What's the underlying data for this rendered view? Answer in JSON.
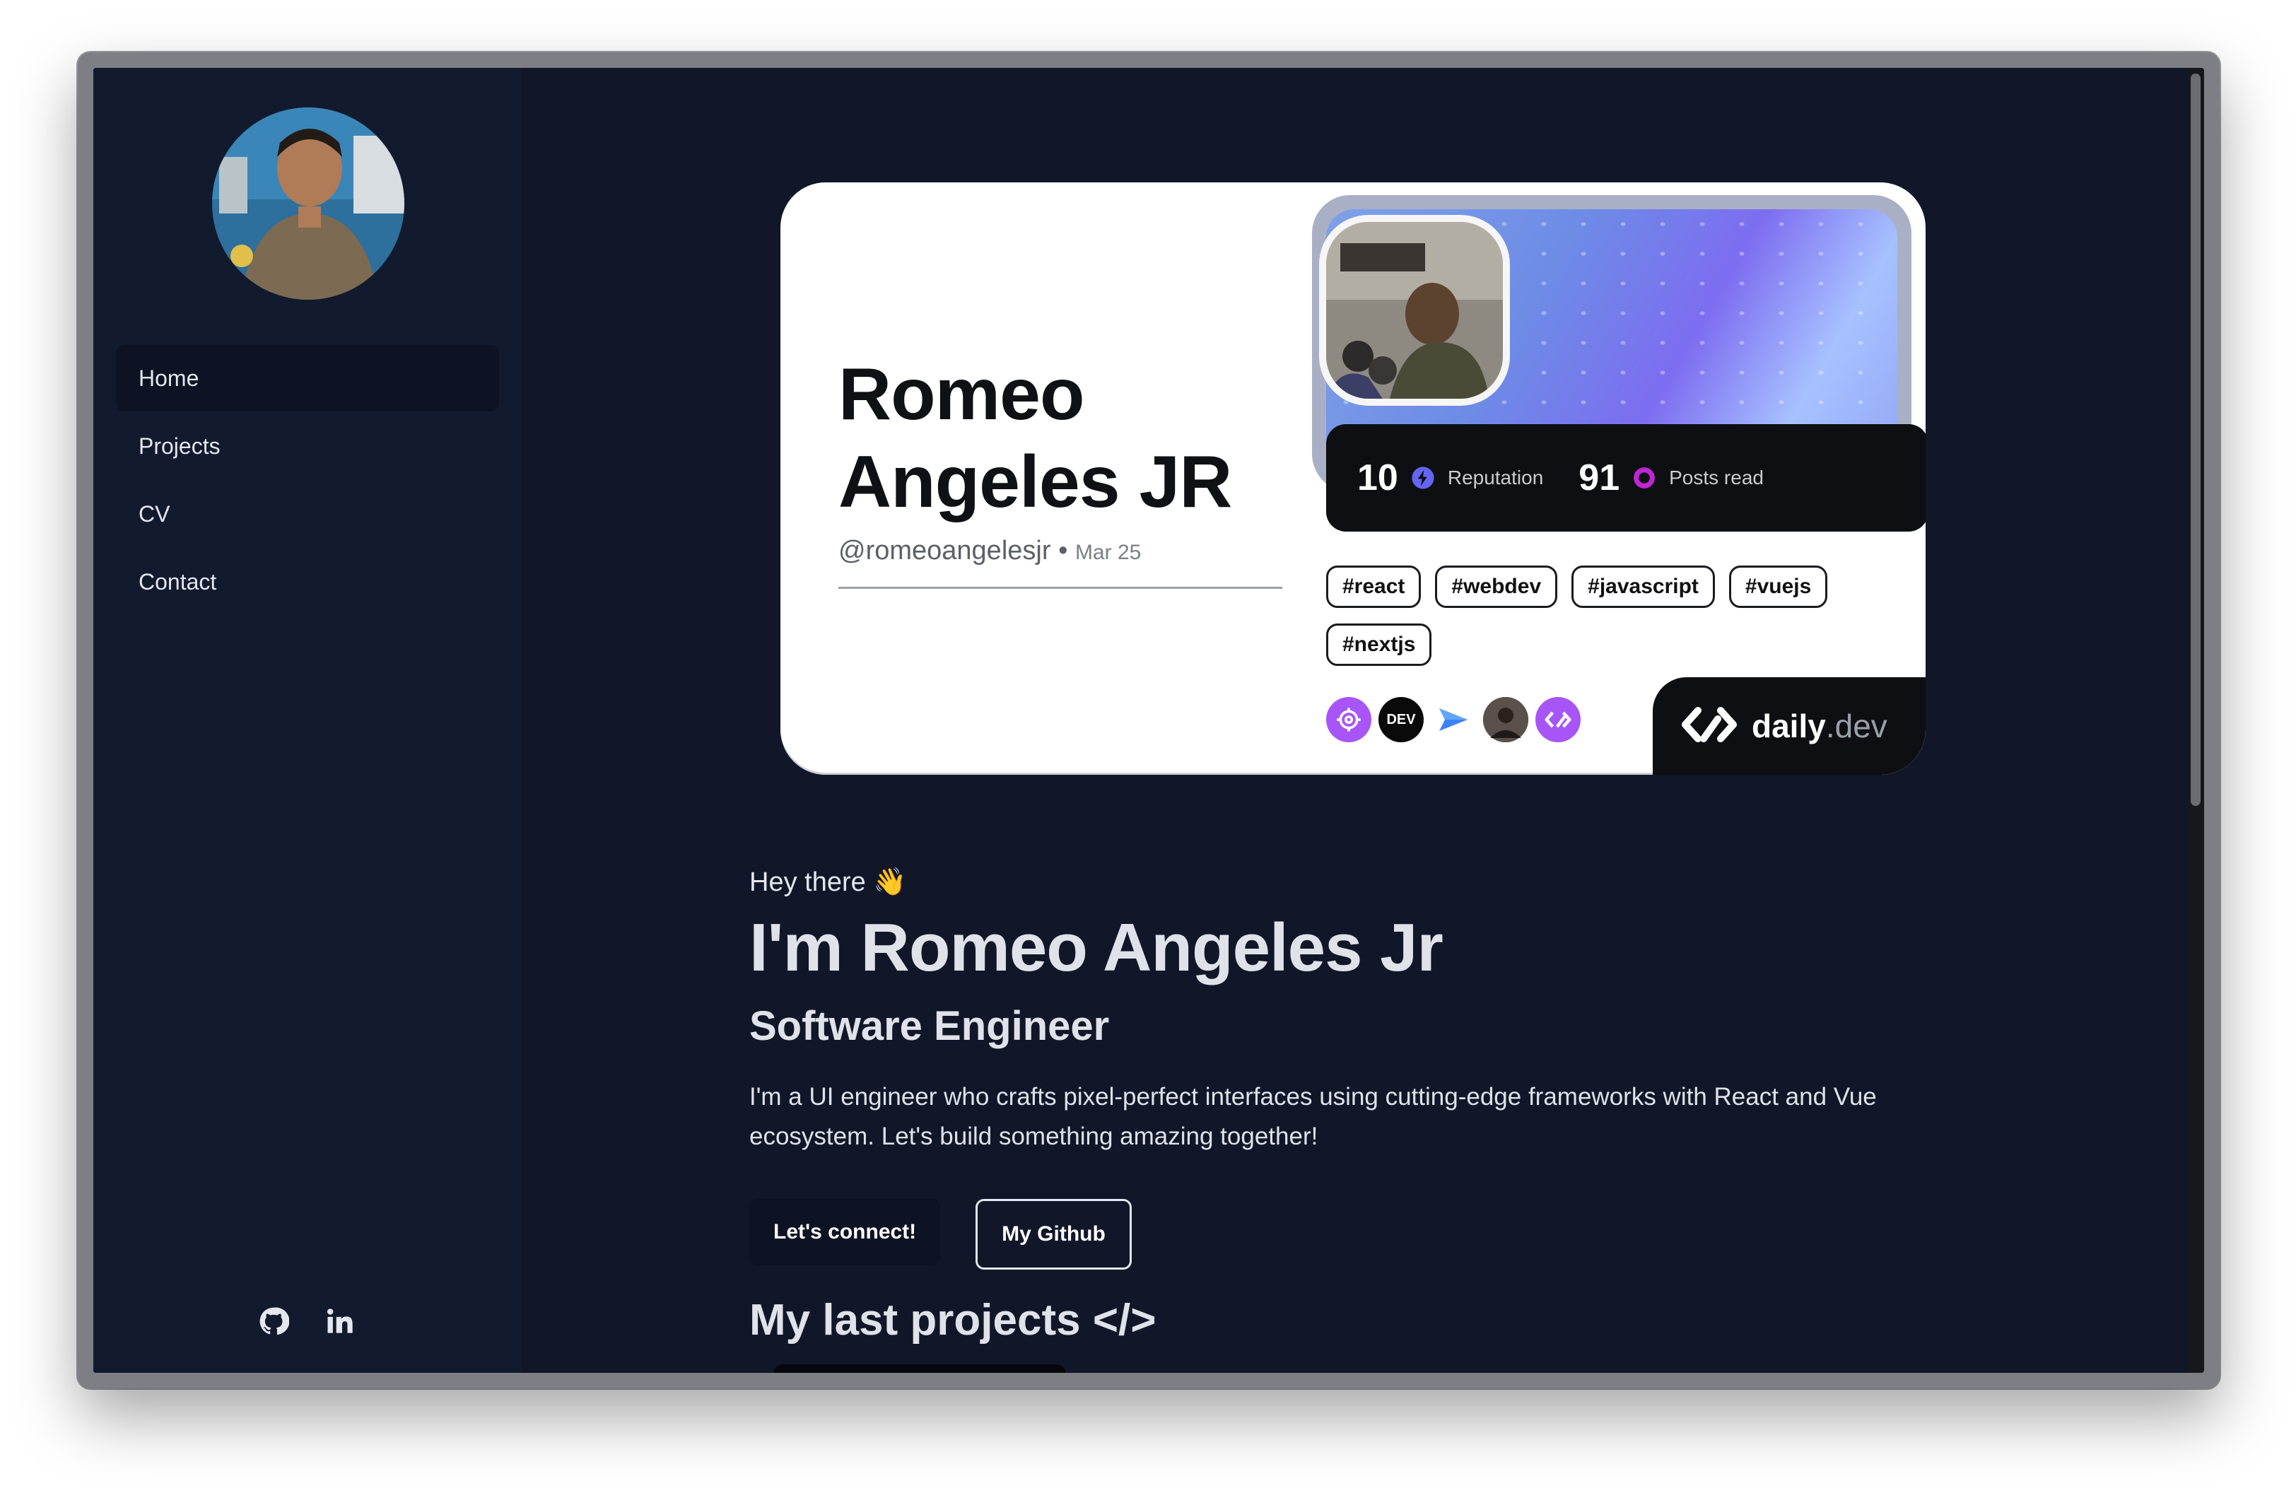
{
  "sidebar": {
    "items": [
      {
        "label": "Home"
      },
      {
        "label": "Projects"
      },
      {
        "label": "CV"
      },
      {
        "label": "Contact"
      }
    ]
  },
  "card": {
    "name_line1": "Romeo",
    "name_line2": "Angeles JR",
    "handle": "@romeoangelesjr",
    "separator": "•",
    "date": "Mar 25",
    "reputation_value": "10",
    "reputation_label": "Reputation",
    "posts_value": "91",
    "posts_label": "Posts read",
    "tags": [
      "#react",
      "#webdev",
      "#javascript",
      "#vuejs",
      "#nextjs"
    ],
    "brand_main": "daily",
    "brand_suffix": ".dev",
    "badge_dev": "DEV"
  },
  "main": {
    "greeting": "Hey there 👋",
    "headline": "I'm Romeo Angeles Jr",
    "role": "Software Engineer",
    "intro": "I'm a UI engineer who crafts pixel-perfect interfaces using cutting-edge frameworks with React and Vue ecosystem. Let's build something amazing together!",
    "connect_label": "Let's connect!",
    "github_label": "My Github",
    "projects_title": "My last projects </>"
  },
  "icons": {
    "github": "github-icon",
    "linkedin": "linkedin-icon",
    "reputation": "lightning-icon",
    "posts": "ring-icon"
  },
  "colors": {
    "background": "#111729",
    "sidebar": "#121a2e",
    "accent_purple": "#a855f7"
  }
}
